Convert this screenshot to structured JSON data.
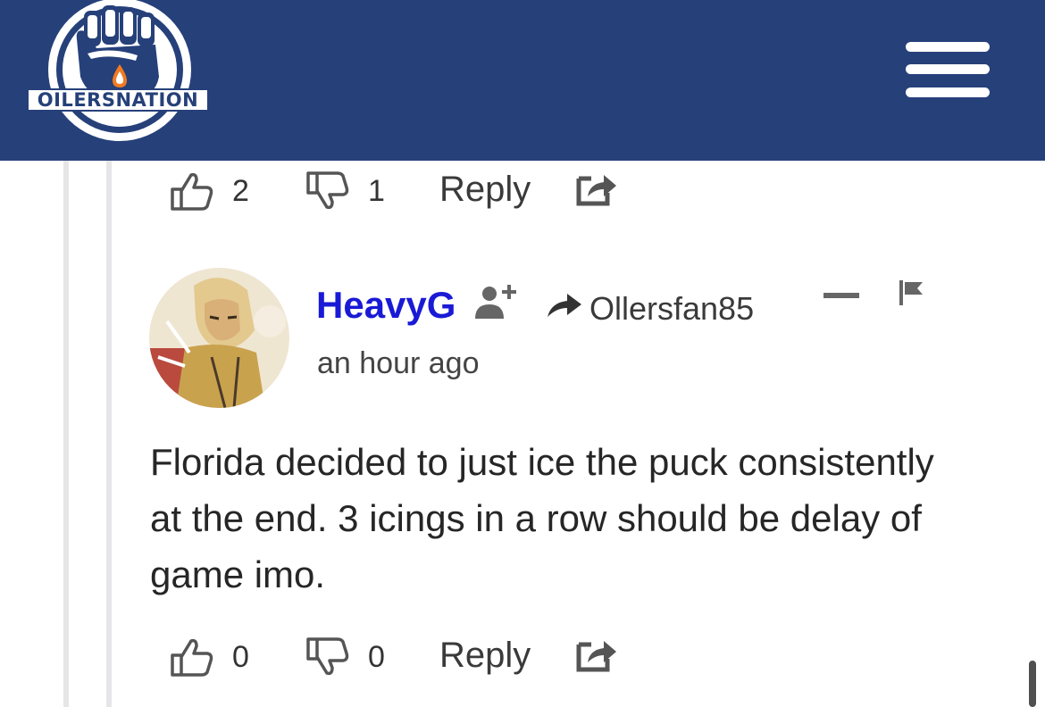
{
  "header": {
    "logo_text": "OILERSNATION",
    "brand_color": "#26407a",
    "menu_icon": "hamburger-menu-icon"
  },
  "previous_comment_actions": {
    "upvotes": "2",
    "downvotes": "1",
    "reply_label": "Reply"
  },
  "comment": {
    "username": "HeavyG",
    "username_color": "#1a1ad6",
    "reply_to": "Ollersfan85",
    "timestamp": "an hour ago",
    "body": "Florida decided to just ice the puck consistently at the end. 3 icings in a row should be delay of game imo.",
    "actions": {
      "upvotes": "0",
      "downvotes": "0",
      "reply_label": "Reply"
    }
  }
}
